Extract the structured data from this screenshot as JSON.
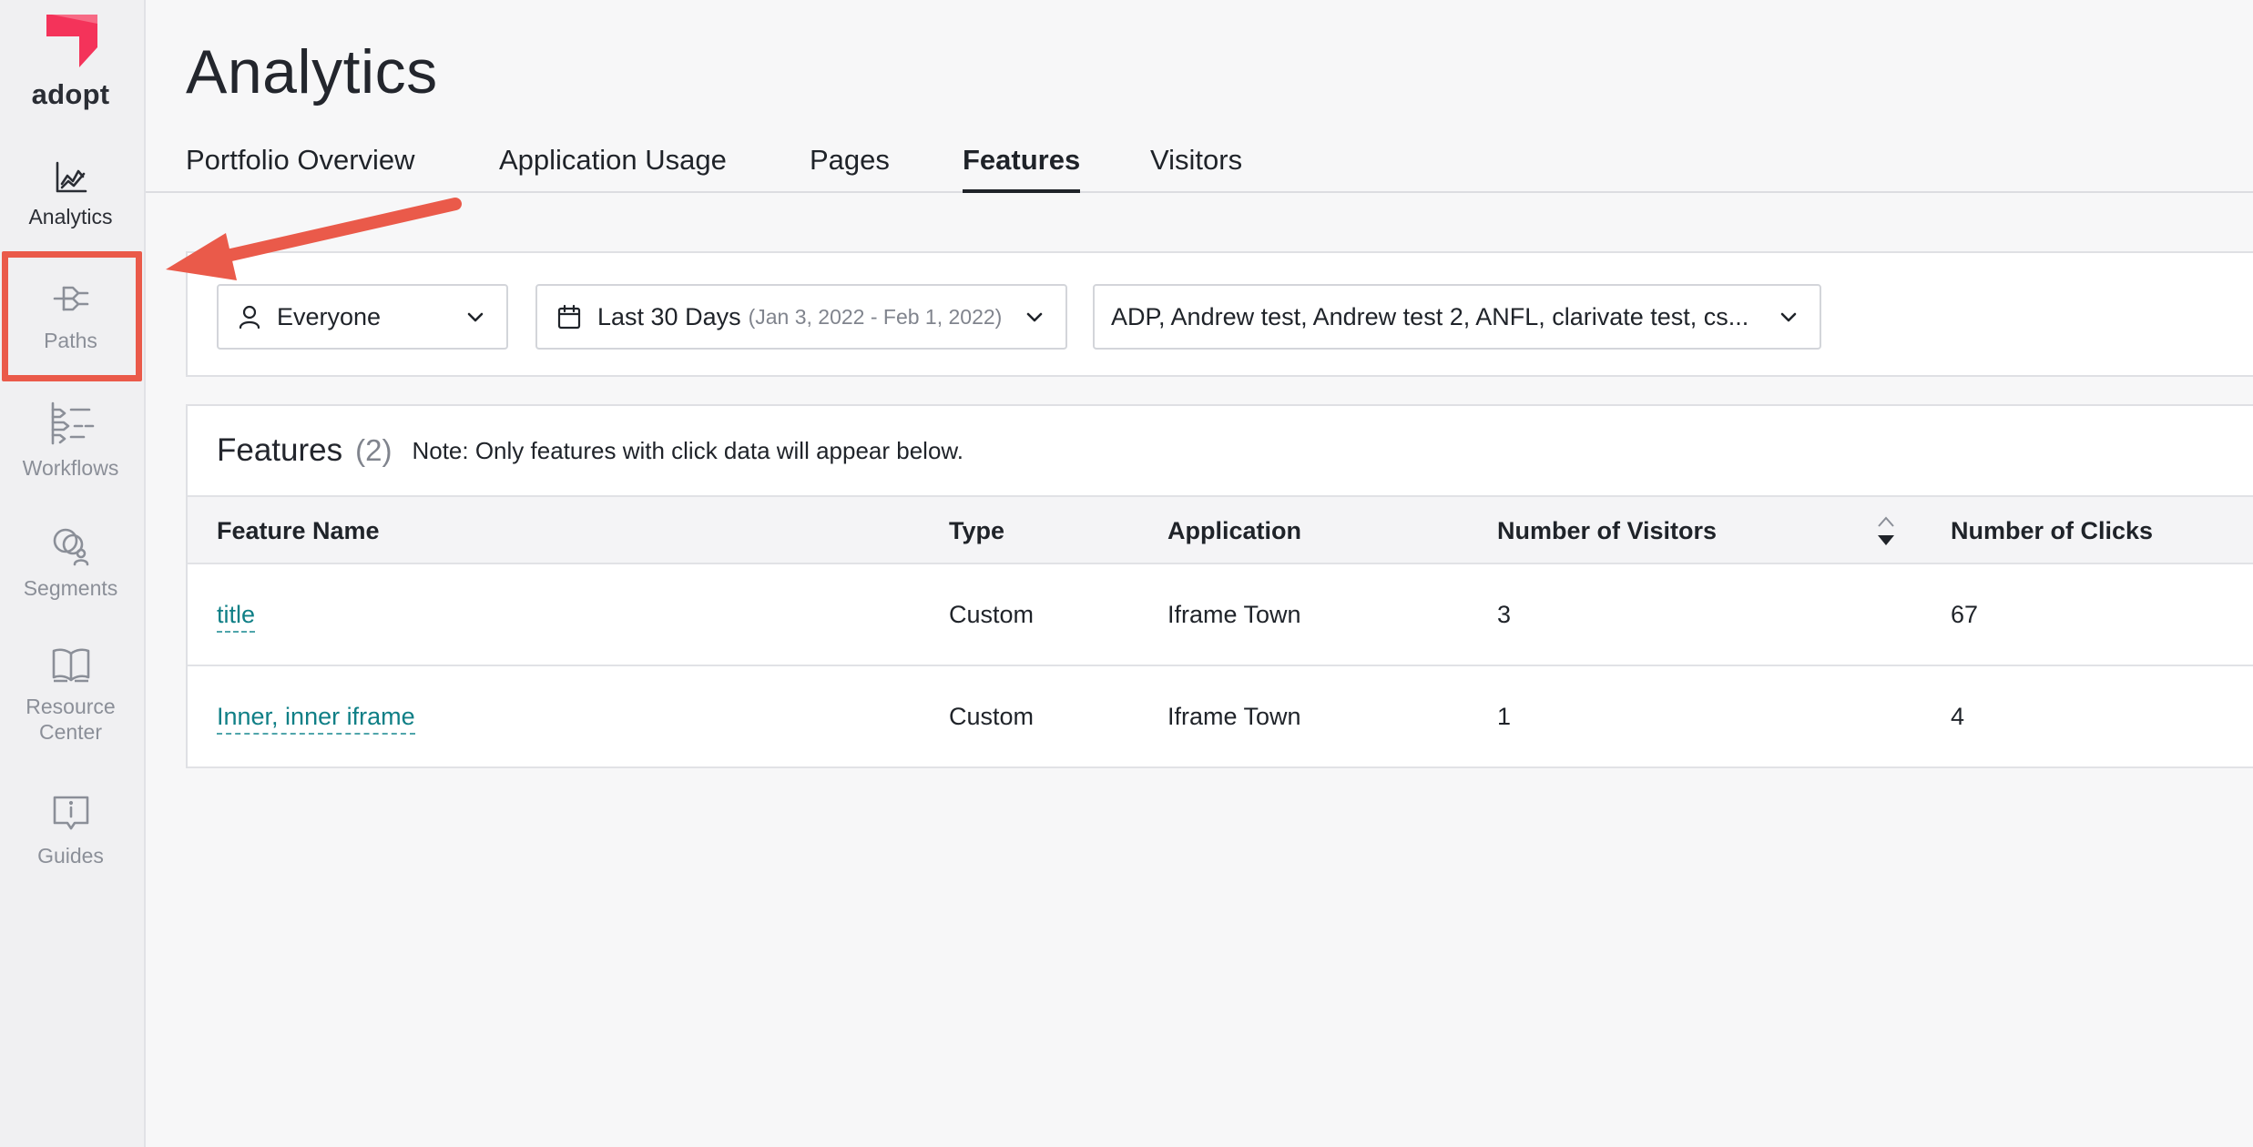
{
  "app": {
    "brand_name": "adopt",
    "brand_color": "#f4335a",
    "highlight_color": "#ea5a4a"
  },
  "sidebar": {
    "items": [
      {
        "label": "Analytics",
        "icon": "line-chart-icon",
        "active": true
      },
      {
        "label": "Paths",
        "icon": "paths-icon",
        "active": false
      },
      {
        "label": "Workflows",
        "icon": "workflows-icon",
        "active": false
      },
      {
        "label": "Segments",
        "icon": "segments-icon",
        "active": false
      },
      {
        "label": "Resource Center",
        "icon": "book-icon",
        "active": false
      },
      {
        "label": "Guides",
        "icon": "guide-message-icon",
        "active": false
      }
    ]
  },
  "header": {
    "title": "Analytics",
    "tabs": [
      {
        "label": "Portfolio Overview",
        "active": false
      },
      {
        "label": "Application Usage",
        "active": false
      },
      {
        "label": "Pages",
        "active": false
      },
      {
        "label": "Features",
        "active": true
      },
      {
        "label": "Visitors",
        "active": false
      }
    ]
  },
  "filters": {
    "segment": {
      "label": "Everyone",
      "icon": "user-icon"
    },
    "date_range": {
      "label": "Last 30 Days",
      "sub": "(Jan 3, 2022 - Feb 1, 2022)",
      "icon": "calendar-icon"
    },
    "applications": {
      "label": "ADP, Andrew test, Andrew test 2, ANFL, clarivate test, cs..."
    }
  },
  "features_card": {
    "title": "Features",
    "count": "(2)",
    "note": "Note: Only features with click data will appear below.",
    "columns": [
      "Feature Name",
      "Type",
      "Application",
      "Number of Visitors",
      "Number of Clicks"
    ],
    "rows": [
      {
        "name": "title",
        "type": "Custom",
        "application": "Iframe Town",
        "visitors": "3",
        "clicks": "67"
      },
      {
        "name": "Inner, inner iframe",
        "type": "Custom",
        "application": "Iframe Town",
        "visitors": "1",
        "clicks": "4"
      }
    ]
  }
}
